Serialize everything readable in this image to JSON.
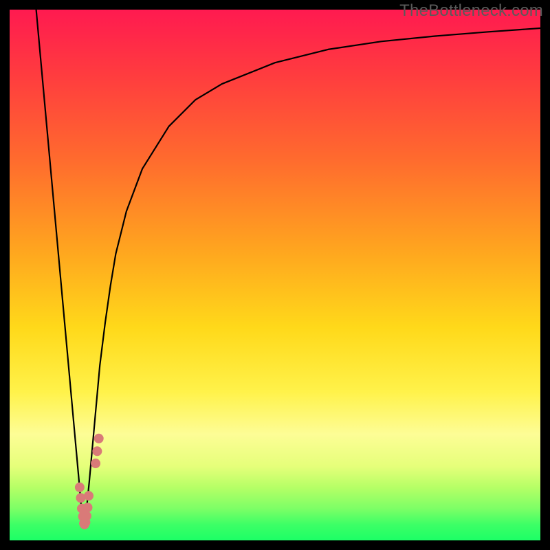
{
  "watermark": "TheBottleneck.com",
  "chart_data": {
    "type": "line",
    "title": "",
    "xlabel": "",
    "ylabel": "",
    "xlim": [
      0,
      100
    ],
    "ylim": [
      0,
      100
    ],
    "series": [
      {
        "name": "bottleneck-curve",
        "x": [
          5,
          6,
          7,
          8,
          9,
          10,
          11,
          12,
          13,
          13.7,
          14.3,
          15,
          16,
          17,
          18,
          19,
          20,
          22,
          25,
          30,
          35,
          40,
          50,
          60,
          70,
          80,
          90,
          100
        ],
        "values": [
          100,
          89,
          78,
          67,
          56,
          45,
          34,
          23,
          12,
          4,
          4,
          11,
          22,
          33,
          41,
          48,
          54,
          62,
          70,
          78,
          83,
          86,
          90,
          92.5,
          94,
          95,
          95.8,
          96.5
        ]
      }
    ],
    "scatter": {
      "name": "data-points",
      "x": [
        13.2,
        13.4,
        13.6,
        13.8,
        14.0,
        14.1,
        14.3,
        14.5,
        14.7,
        14.9,
        16.2,
        16.5,
        16.8
      ],
      "values": [
        10,
        8,
        6,
        4.5,
        3.2,
        3.0,
        3.4,
        4.6,
        6.2,
        8.4,
        14.5,
        16.8,
        19.2
      ]
    }
  }
}
